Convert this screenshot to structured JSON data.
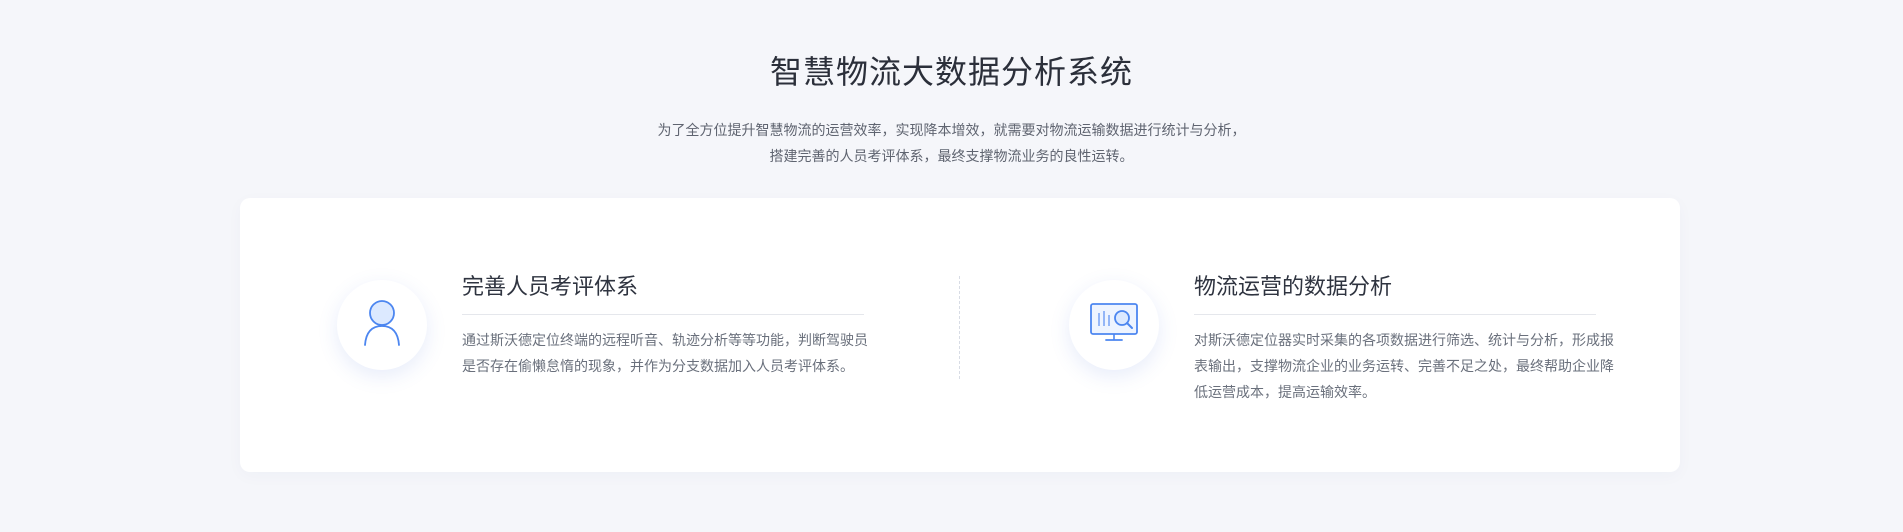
{
  "header": {
    "title": "智慧物流大数据分析系统",
    "description_line1": "为了全方位提升智慧物流的运营效率，实现降本增效，就需要对物流运输数据进行统计与分析，",
    "description_line2": "搭建完善的人员考评体系，最终支撑物流业务的良性运转。"
  },
  "features": [
    {
      "title": "完善人员考评体系",
      "description": "通过斯沃德定位终端的远程听音、轨迹分析等等功能，判断驾驶员是否存在偷懒怠惰的现象，并作为分支数据加入人员考评体系。",
      "icon": "user-icon"
    },
    {
      "title": "物流运营的数据分析",
      "description": "对斯沃德定位器实时采集的各项数据进行筛选、统计与分析，形成报表输出，支撑物流企业的业务运转、完善不足之处，最终帮助企业降低运营成本，提高运输效率。",
      "icon": "monitor-search-icon"
    }
  ],
  "colors": {
    "page_background": "#f5f6fa",
    "card_background": "#ffffff",
    "icon_accent": "#3f7df0",
    "title_text": "#2b2f3a",
    "body_text": "#6a707c"
  }
}
